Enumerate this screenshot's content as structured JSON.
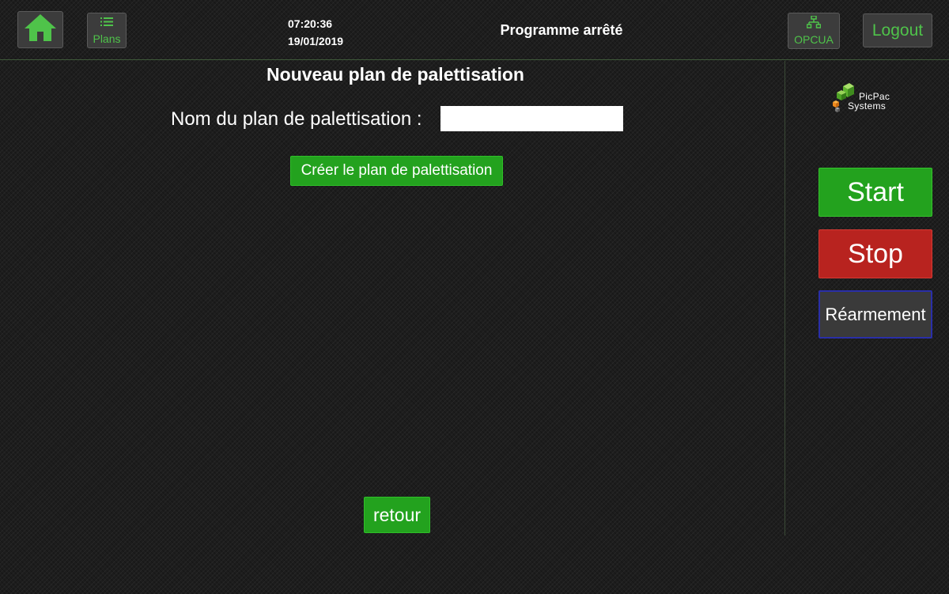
{
  "header": {
    "home_icon": "home-icon",
    "plans": {
      "label": "Plans",
      "icon": "list-icon"
    },
    "clock": {
      "time": "07:20:36",
      "date": "19/01/2019"
    },
    "status": "Programme arrêté",
    "opcua": {
      "label": "OPCUA",
      "icon": "network-icon"
    },
    "logout_label": "Logout"
  },
  "main": {
    "title": "Nouveau plan de palettisation",
    "name_label": "Nom du plan de palettisation :",
    "name_value": "",
    "create_label": "Créer le plan de palettisation",
    "back_label": "retour"
  },
  "side": {
    "logo": {
      "line1": "PicPac",
      "line2": "Systems"
    },
    "start_label": "Start",
    "stop_label": "Stop",
    "reset_label": "Réarmement"
  },
  "colors": {
    "accent_green": "#23a21e",
    "label_green": "#4fc34a",
    "stop_red": "#b8231f",
    "reset_border": "#2a2fa8"
  }
}
